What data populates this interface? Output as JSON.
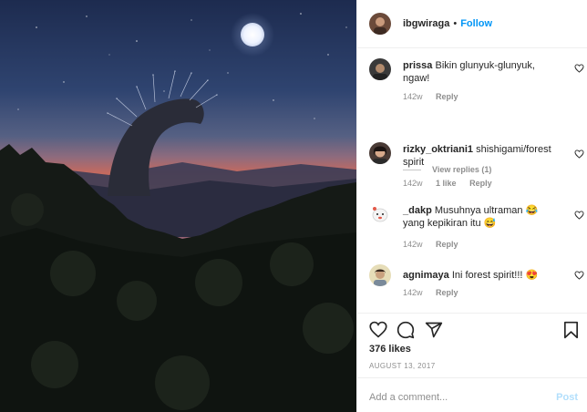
{
  "header": {
    "username": "ibgwiraga",
    "separator": "•",
    "follow_label": "Follow"
  },
  "comments": [
    {
      "username": "prissa",
      "text": "Bikin glunyuk-glunyuk, ngaw!",
      "age": "142w",
      "likes": "",
      "reply_label": "Reply",
      "avatar_icon": "avatar-prissa"
    },
    {
      "username": "rizky_oktriani1",
      "text": "shishigami/forest spirit",
      "age": "142w",
      "likes": "1 like",
      "reply_label": "Reply",
      "avatar_icon": "avatar-rizky"
    },
    {
      "username": "_dakp",
      "text": "Musuhnya ultraman 😂  yang kepikiran itu 😅",
      "age": "142w",
      "likes": "",
      "reply_label": "Reply",
      "avatar_icon": "avatar-dakp"
    },
    {
      "username": "agnimaya",
      "text": "Ini forest spirit!!! 😍",
      "age": "142w",
      "likes": "",
      "reply_label": "Reply",
      "avatar_icon": "avatar-agnimaya"
    }
  ],
  "view_replies_label": "View replies (1)",
  "actions": {
    "like_icon": "heart-icon",
    "comment_icon": "comment-icon",
    "share_icon": "share-icon",
    "save_icon": "bookmark-icon"
  },
  "likes_label": "376 likes",
  "date_label": "AUGUST 13, 2017",
  "add_comment": {
    "placeholder": "Add a comment...",
    "post_label": "Post"
  },
  "colors": {
    "link_blue": "#0095f6",
    "post_disabled": "#b2dffc",
    "muted": "#8e8e8e"
  }
}
